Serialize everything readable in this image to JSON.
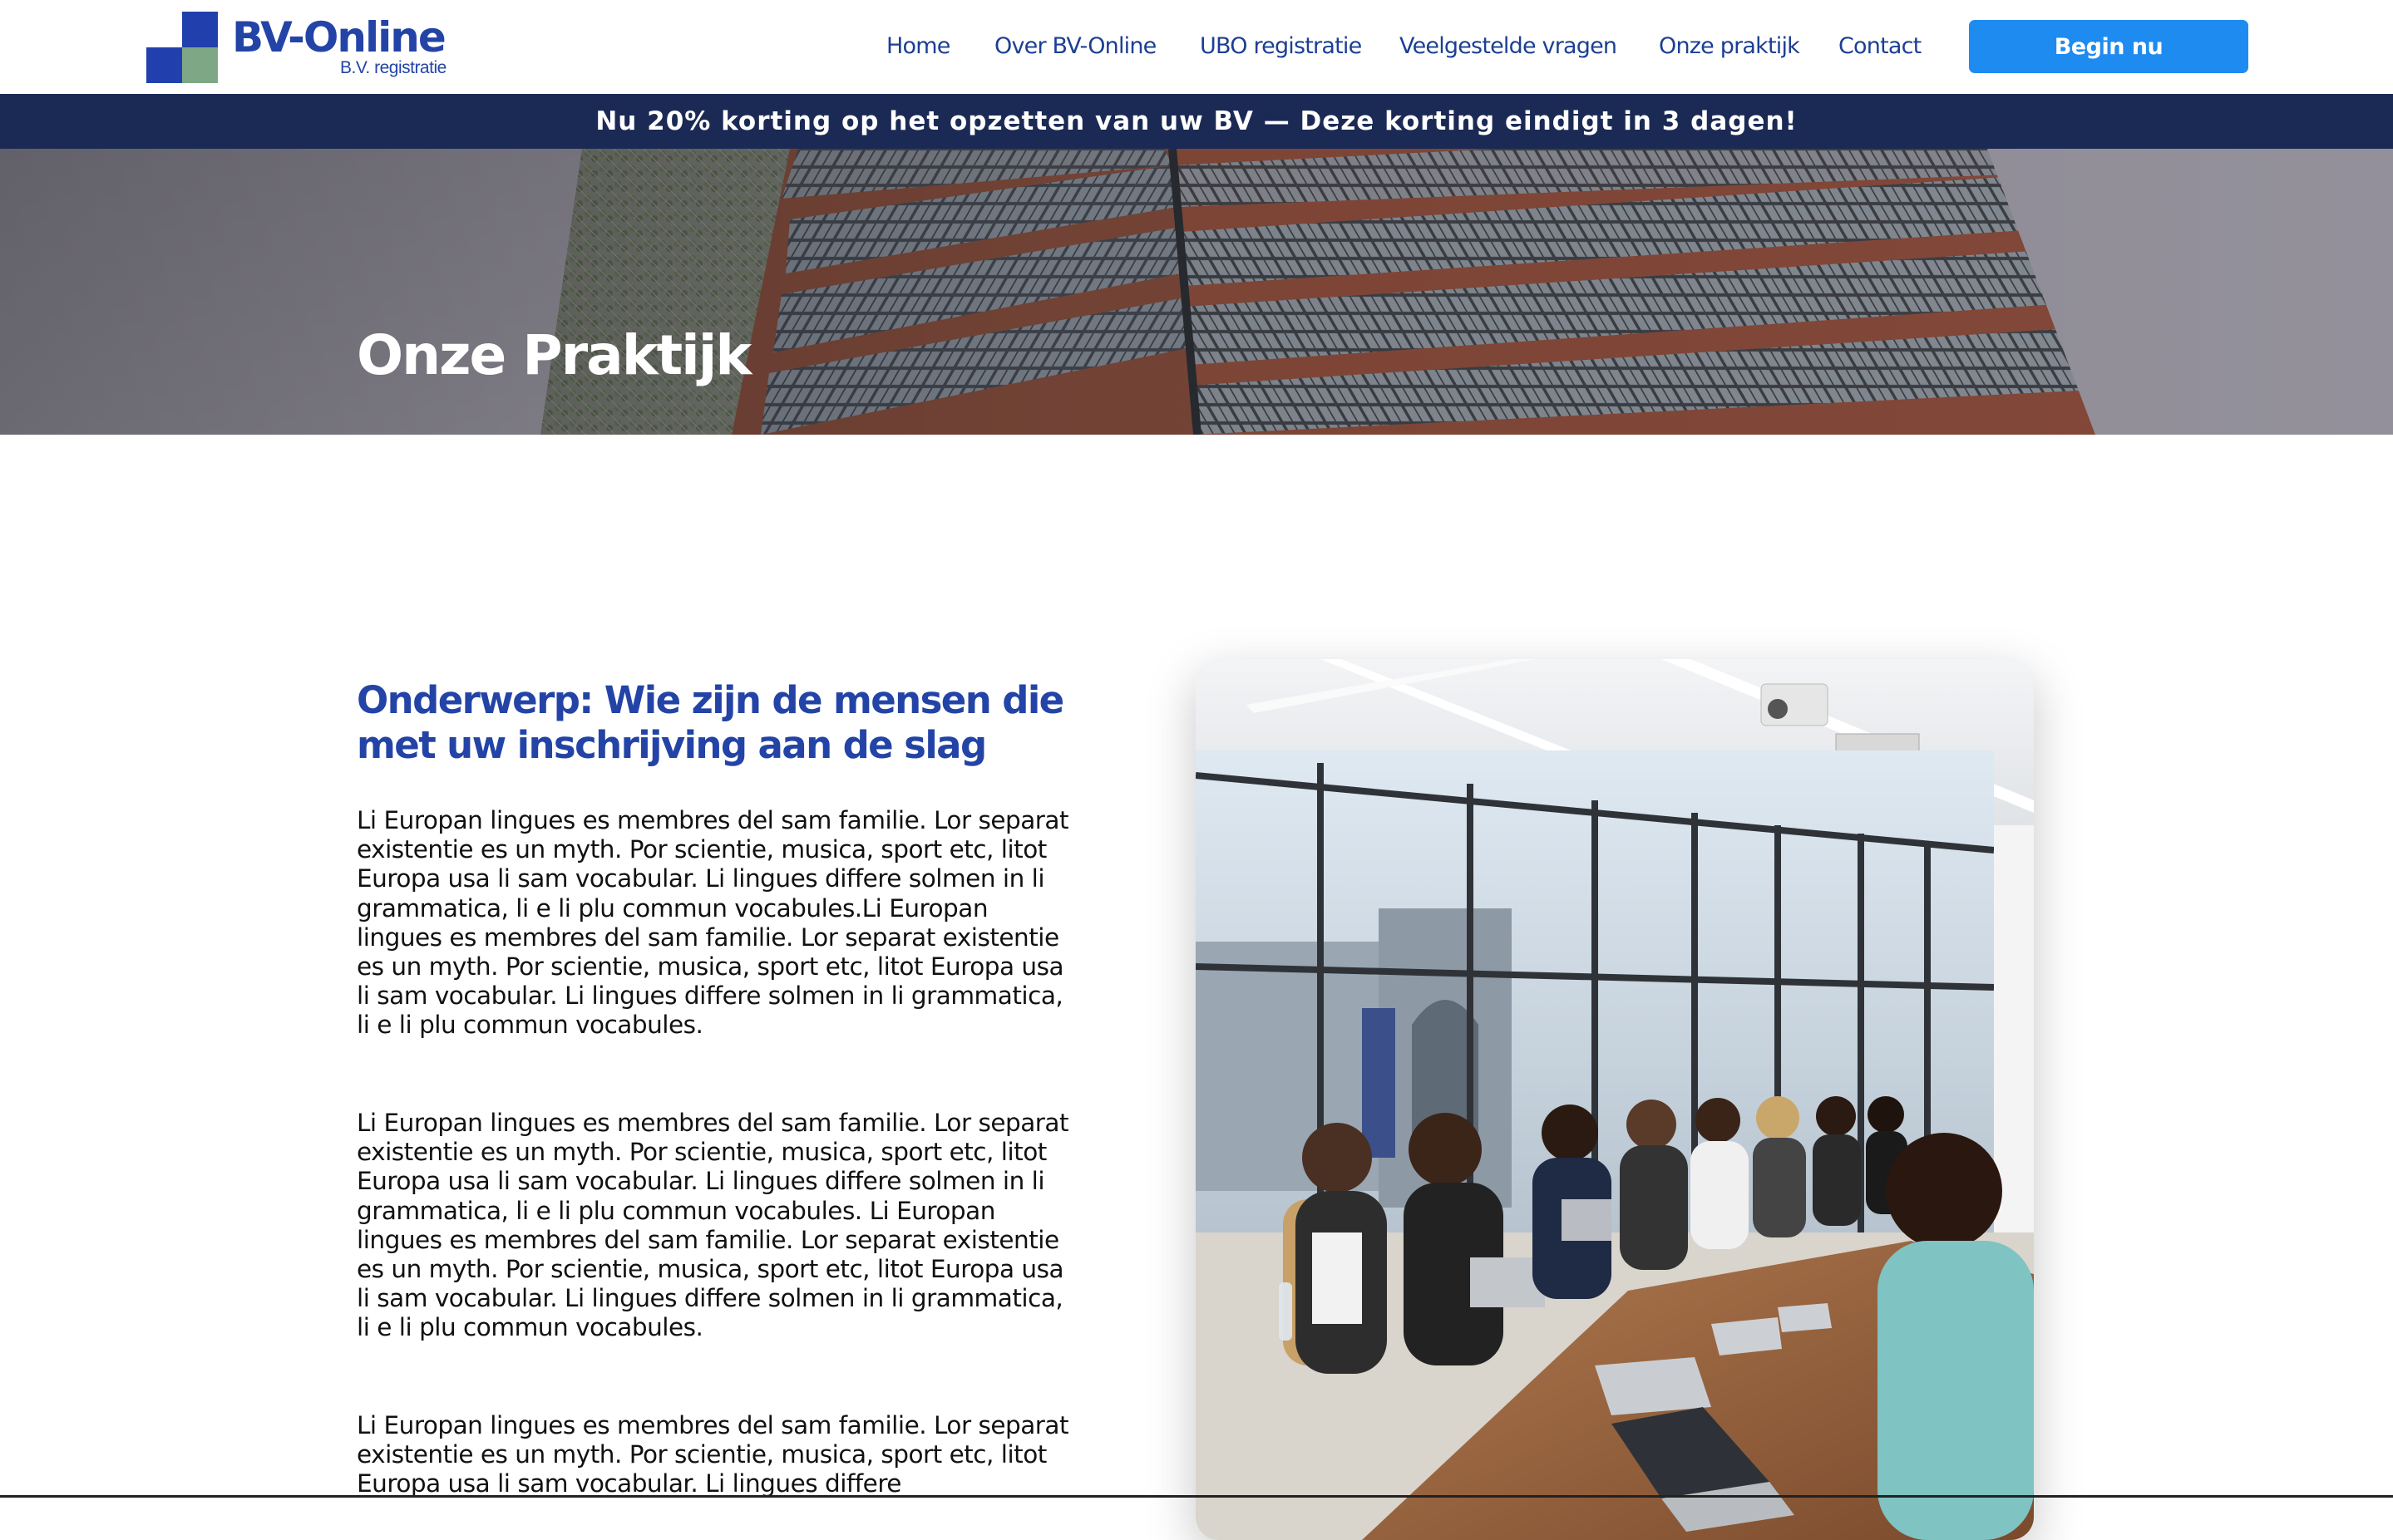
{
  "brand": {
    "name": "BV-Online",
    "tagline": "B.V. registratie",
    "colors": {
      "primary": "#2344a6",
      "accent_button": "#1e8bf1",
      "banner_bg": "#1b2a55",
      "logo_green": "#7ea885",
      "logo_blue": "#2240ad"
    }
  },
  "nav": {
    "items": [
      {
        "label": "Home"
      },
      {
        "label": "Over BV-Online"
      },
      {
        "label": "UBO registratie"
      },
      {
        "label": "Veelgestelde vragen"
      },
      {
        "label": "Onze praktijk"
      },
      {
        "label": "Contact"
      }
    ],
    "cta_label": "Begin nu"
  },
  "promo": {
    "text": "Nu 20% korting op het opzetten van uw BV — Deze korting eindigt in 3 dagen!"
  },
  "hero": {
    "title": "Onze Praktijk"
  },
  "main": {
    "heading": "Onderwerp: Wie zijn de mensen die met uw inschrijving aan de slag",
    "paragraphs": [
      "Li Europan lingues es membres del sam familie. Lor separat existentie es un myth. Por scientie, musica, sport etc, litot Europa usa li sam vocabular. Li lingues differe solmen in li grammatica, li  e li plu commun vocabules.Li Europan lingues es membres del sam familie. Lor separat existentie es un myth. Por scientie, musica, sport etc, litot Europa usa li sam vocabular. Li lingues differe solmen in li grammatica, li  e li plu commun vocabules.",
      "Li Europan lingues es membres del sam familie. Lor separat existentie es un myth. Por scientie, musica, sport etc, litot Europa usa li sam vocabular. Li lingues differe solmen in li grammatica, li  e li plu commun vocabules. Li Europan lingues es membres del sam familie. Lor separat existentie es un myth. Por scientie, musica, sport etc, litot Europa usa li sam vocabular. Li lingues differe solmen in li grammatica, li  e li plu commun vocabules.",
      "Li Europan lingues es membres del sam familie. Lor separat existentie es un myth. Por scientie, musica, sport etc, litot Europa usa li sam vocabular. Li lingues differe"
    ]
  }
}
